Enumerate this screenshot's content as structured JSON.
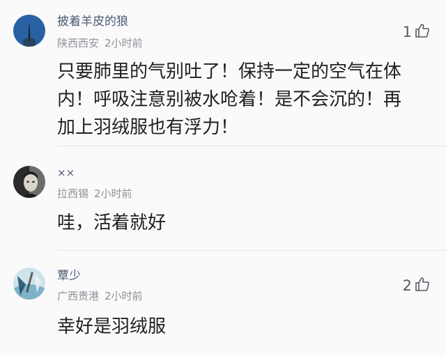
{
  "comments": [
    {
      "username": "披着羊皮的狼",
      "location": "陕西西安",
      "time": "2小时前",
      "text": "只要肺里的气别吐了！保持一定的空气在体内！呼吸注意别被水呛着！是不会沉的！再加上羽绒服也有浮力！",
      "likes": "1",
      "avatar_color": "#2f5fa0"
    },
    {
      "username": "××",
      "location": "拉西锡",
      "time": "2小时前",
      "text": "哇，活着就好",
      "likes": "",
      "avatar_color": "#3a3a3a"
    },
    {
      "username": "覃少",
      "location": "广西贵港",
      "time": "2小时前",
      "text": "幸好是羽绒服",
      "likes": "2",
      "avatar_color": "#5b8fb0"
    }
  ],
  "icons": {
    "like": "thumbs-up-icon"
  }
}
